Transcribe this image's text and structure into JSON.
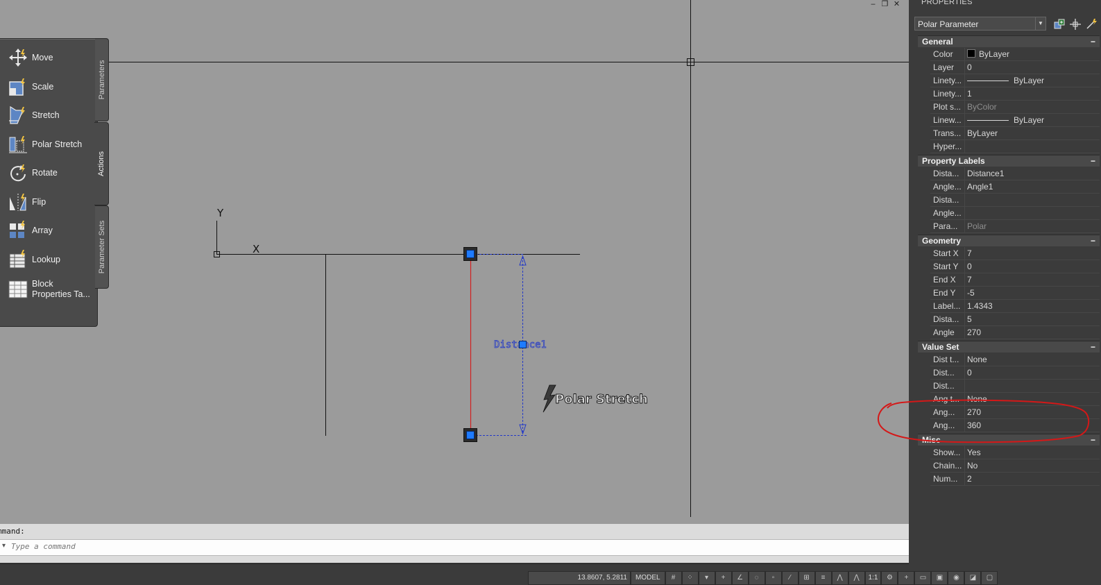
{
  "window_controls": [
    "‒",
    "❐",
    "✕"
  ],
  "palette": {
    "tools": [
      {
        "label": "Move",
        "icon": "move-icon"
      },
      {
        "label": "Scale",
        "icon": "scale-icon"
      },
      {
        "label": "Stretch",
        "icon": "stretch-icon"
      },
      {
        "label": "Polar Stretch",
        "icon": "polar-stretch-icon"
      },
      {
        "label": "Rotate",
        "icon": "rotate-icon"
      },
      {
        "label": "Flip",
        "icon": "flip-icon"
      },
      {
        "label": "Array",
        "icon": "array-icon"
      },
      {
        "label": "Lookup",
        "icon": "lookup-icon"
      },
      {
        "label": "Block Properties Ta...",
        "icon": "block-properties-table-icon"
      }
    ],
    "tabs": [
      "Parameters",
      "Actions",
      "Parameter Sets"
    ],
    "active_tab": "Actions"
  },
  "drawing": {
    "ucs_y": "Y",
    "ucs_x": "X",
    "parameter_label": "Distance1",
    "action_label": "Polar Stretch"
  },
  "command": {
    "history": "mmand:",
    "placeholder": "Type a command"
  },
  "statusbar": {
    "coords": "13.8607, 5.2811",
    "model": "MODEL",
    "scale": "1:1"
  },
  "properties": {
    "title": "PROPERTIES",
    "selected": "Polar Parameter",
    "sections": [
      {
        "title": "General",
        "rows": [
          {
            "key": "Color",
            "value": "ByLayer"
          },
          {
            "key": "Layer",
            "value": "0"
          },
          {
            "key": "Linety...",
            "value": "ByLayer"
          },
          {
            "key": "Linety...",
            "value": "1"
          },
          {
            "key": "Plot s...",
            "value": "ByColor"
          },
          {
            "key": "Linew...",
            "value": "ByLayer"
          },
          {
            "key": "Trans...",
            "value": "ByLayer"
          },
          {
            "key": "Hyper...",
            "value": ""
          }
        ]
      },
      {
        "title": "Property Labels",
        "rows": [
          {
            "key": "Dista...",
            "value": "Distance1"
          },
          {
            "key": "Angle...",
            "value": "Angle1"
          },
          {
            "key": "Dista...",
            "value": ""
          },
          {
            "key": "Angle...",
            "value": ""
          },
          {
            "key": "Para...",
            "value": "Polar"
          }
        ]
      },
      {
        "title": "Geometry",
        "rows": [
          {
            "key": "Start X",
            "value": "7"
          },
          {
            "key": "Start Y",
            "value": "0"
          },
          {
            "key": "End X",
            "value": "7"
          },
          {
            "key": "End Y",
            "value": "-5"
          },
          {
            "key": "Label...",
            "value": "1.4343"
          },
          {
            "key": "Dista...",
            "value": "5"
          },
          {
            "key": "Angle",
            "value": "270"
          }
        ]
      },
      {
        "title": "Value Set",
        "rows": [
          {
            "key": "Dist t...",
            "value": "None"
          },
          {
            "key": "Dist...",
            "value": "0"
          },
          {
            "key": "Dist...",
            "value": ""
          },
          {
            "key": "Ang t...",
            "value": "None"
          },
          {
            "key": "Ang...",
            "value": "270"
          },
          {
            "key": "Ang...",
            "value": "360"
          }
        ]
      },
      {
        "title": "Misc",
        "rows": [
          {
            "key": "Show...",
            "value": "Yes"
          },
          {
            "key": "Chain...",
            "value": "No"
          },
          {
            "key": "Num...",
            "value": "2"
          }
        ]
      }
    ],
    "collapse_symbol": "−"
  },
  "colors": {
    "canvas": "#9b9b9b",
    "grip": "#1e7bff",
    "selected_line": "#d32020",
    "dimension": "#2238c8",
    "annotation": "#d41818"
  }
}
